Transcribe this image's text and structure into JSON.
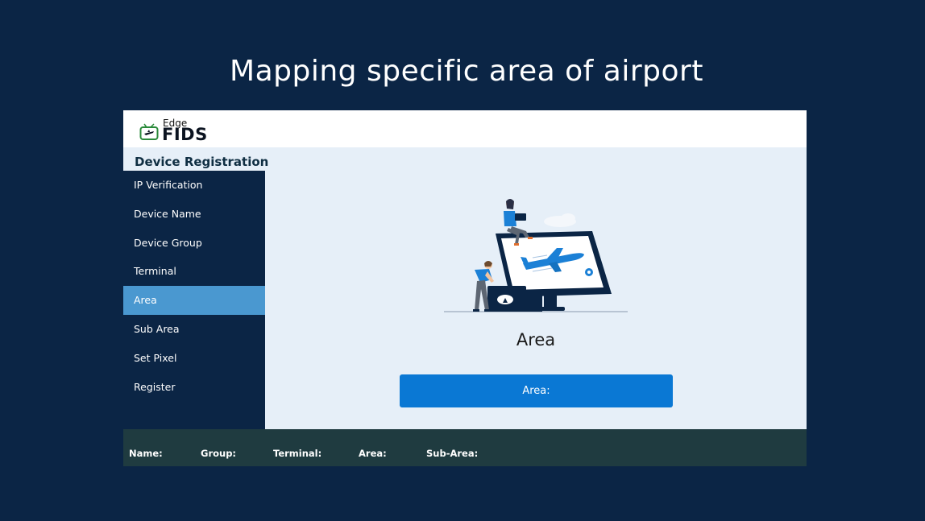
{
  "slide": {
    "title": "Mapping specific area of airport"
  },
  "app": {
    "logo": {
      "top_text": "Edge",
      "main_text": "FIDS"
    },
    "section_title": "Device Registration",
    "sidebar": {
      "items": [
        {
          "label": "IP Verification",
          "active": false
        },
        {
          "label": "Device Name",
          "active": false
        },
        {
          "label": "Device Group",
          "active": false
        },
        {
          "label": "Terminal",
          "active": false
        },
        {
          "label": "Area",
          "active": true
        },
        {
          "label": "Sub Area",
          "active": false
        },
        {
          "label": "Set Pixel",
          "active": false
        },
        {
          "label": "Register",
          "active": false
        }
      ]
    },
    "main": {
      "step_title": "Area",
      "area_button_label": "Area:"
    },
    "footer": {
      "fields": [
        "Name:",
        "Group:",
        "Terminal:",
        "Area:",
        "Sub-Area:"
      ]
    }
  },
  "colors": {
    "background": "#0b2545",
    "accent": "#0a78d4",
    "sidebar_active": "#4a98d0",
    "panel": "#e6eff8",
    "footer": "#1f3b40"
  },
  "icons": [
    "plane-tv-logo-icon",
    "airport-illustration"
  ]
}
